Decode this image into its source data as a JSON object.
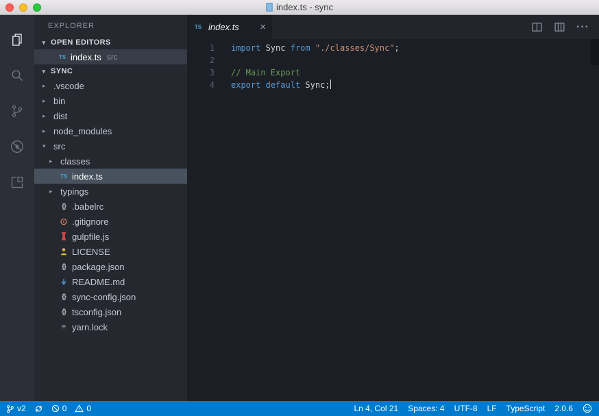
{
  "titlebar": {
    "title": "index.ts - sync"
  },
  "activity_bar": {
    "items": [
      {
        "id": "explorer",
        "icon": "files-icon",
        "active": true
      },
      {
        "id": "search",
        "icon": "search-icon",
        "active": false
      },
      {
        "id": "source-control",
        "icon": "git-branch-icon",
        "active": false
      },
      {
        "id": "debug",
        "icon": "debug-icon",
        "active": false
      },
      {
        "id": "extensions",
        "icon": "extensions-icon",
        "active": false
      }
    ]
  },
  "sidebar": {
    "title": "EXPLORER",
    "open_editors": {
      "label": "OPEN EDITORS",
      "items": [
        {
          "label": "index.ts",
          "detail": "src",
          "icon": "ts",
          "selected": true
        }
      ]
    },
    "tree": {
      "root": "SYNC",
      "items": [
        {
          "label": ".vscode",
          "type": "folder",
          "collapsed": true,
          "indent": 0
        },
        {
          "label": "bin",
          "type": "folder",
          "collapsed": true,
          "indent": 0
        },
        {
          "label": "dist",
          "type": "folder",
          "collapsed": true,
          "indent": 0
        },
        {
          "label": "node_modules",
          "type": "folder",
          "collapsed": true,
          "indent": 0
        },
        {
          "label": "src",
          "type": "folder",
          "collapsed": false,
          "indent": 0
        },
        {
          "label": "classes",
          "type": "folder",
          "collapsed": true,
          "indent": 1
        },
        {
          "label": "index.ts",
          "type": "file",
          "icon": "ts",
          "indent": 1,
          "selected": true
        },
        {
          "label": "typings",
          "type": "folder",
          "collapsed": true,
          "indent": 1
        },
        {
          "label": ".babelrc",
          "type": "file",
          "icon": "json",
          "indent": 1
        },
        {
          "label": ".gitignore",
          "type": "file",
          "icon": "git",
          "indent": 1
        },
        {
          "label": "gulpfile.js",
          "type": "file",
          "icon": "gulp",
          "indent": 1
        },
        {
          "label": "LICENSE",
          "type": "file",
          "icon": "license",
          "indent": 1
        },
        {
          "label": "package.json",
          "type": "file",
          "icon": "json",
          "indent": 1
        },
        {
          "label": "README.md",
          "type": "file",
          "icon": "markdown",
          "indent": 1
        },
        {
          "label": "sync-config.json",
          "type": "file",
          "icon": "json",
          "indent": 1
        },
        {
          "label": "tsconfig.json",
          "type": "file",
          "icon": "json",
          "indent": 1
        },
        {
          "label": "yarn.lock",
          "type": "file",
          "icon": "lock",
          "indent": 1
        }
      ]
    }
  },
  "editor": {
    "tab": {
      "label": "index.ts",
      "icon": "ts",
      "close": "×"
    },
    "actions": [
      {
        "id": "split-editor"
      },
      {
        "id": "toggle-layout"
      },
      {
        "id": "more-actions"
      }
    ],
    "lines": [
      {
        "number": "1",
        "tokens": [
          {
            "t": "import",
            "c": "kw"
          },
          {
            "t": " Sync ",
            "c": "pl"
          },
          {
            "t": "from",
            "c": "kw"
          },
          {
            "t": " ",
            "c": "pl"
          },
          {
            "t": "\"./classes/Sync\"",
            "c": "str"
          },
          {
            "t": ";",
            "c": "pl"
          }
        ]
      },
      {
        "number": "2",
        "tokens": []
      },
      {
        "number": "3",
        "tokens": [
          {
            "t": "// Main Export",
            "c": "comment"
          }
        ]
      },
      {
        "number": "4",
        "cursor": true,
        "tokens": [
          {
            "t": "export",
            "c": "kw"
          },
          {
            "t": " ",
            "c": "pl"
          },
          {
            "t": "default",
            "c": "kw"
          },
          {
            "t": " Sync;",
            "c": "pl"
          }
        ]
      }
    ]
  },
  "statusbar": {
    "accent_color": "#007acc",
    "left": [
      {
        "id": "branch",
        "icon": "git-branch-icon",
        "label": "v2"
      },
      {
        "id": "sync",
        "icon": "sync-icon",
        "label": ""
      },
      {
        "id": "errors",
        "icon": "errors-icon",
        "label": "0"
      },
      {
        "id": "warnings",
        "icon": "warnings-icon",
        "label": "0"
      }
    ],
    "right": [
      {
        "id": "cursor-position",
        "label": "Ln 4, Col 21"
      },
      {
        "id": "indentation",
        "label": "Spaces: 4"
      },
      {
        "id": "encoding",
        "label": "UTF-8"
      },
      {
        "id": "eol",
        "label": "LF"
      },
      {
        "id": "language-mode",
        "label": "TypeScript"
      },
      {
        "id": "typescript-version",
        "label": "2.0.6"
      },
      {
        "id": "feedback",
        "icon": "smiley-icon",
        "label": ""
      }
    ]
  }
}
